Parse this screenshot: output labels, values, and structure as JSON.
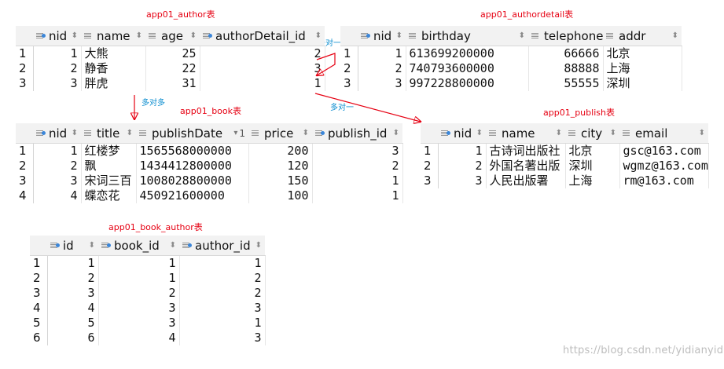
{
  "labels": {
    "author_title": "app01_author表",
    "authordetail_title": "app01_authordetail表",
    "book_title": "app01_book表",
    "publish_title": "app01_publish表",
    "book_author_title": "app01_book_author表",
    "one_to_one": "一对一",
    "many_to_many": "多对多",
    "many_to_one": "多对一"
  },
  "author": {
    "columns": [
      "nid",
      "name",
      "age",
      "authorDetail_id"
    ],
    "rows": [
      [
        "1",
        "1",
        "大熊",
        "25",
        "2"
      ],
      [
        "2",
        "2",
        "静香",
        "22",
        "3"
      ],
      [
        "3",
        "3",
        "胖虎",
        "31",
        "1"
      ]
    ]
  },
  "authordetail": {
    "columns": [
      "nid",
      "birthday",
      "telephone",
      "addr"
    ],
    "rows": [
      [
        "1",
        "1",
        "613699200000",
        "66666",
        "北京"
      ],
      [
        "2",
        "2",
        "740793600000",
        "88888",
        "上海"
      ],
      [
        "3",
        "3",
        "997228800000",
        "55555",
        "深圳"
      ]
    ]
  },
  "book": {
    "columns": [
      "nid",
      "title",
      "publishDate",
      "price",
      "publish_id"
    ],
    "sort_badge": "1",
    "rows": [
      [
        "1",
        "1",
        "红楼梦",
        "1565568000000",
        "200",
        "3"
      ],
      [
        "2",
        "2",
        "飘",
        "1434412800000",
        "120",
        "2"
      ],
      [
        "3",
        "3",
        "宋词三百",
        "1008028800000",
        "150",
        "1"
      ],
      [
        "4",
        "4",
        "蝶恋花",
        "450921600000",
        "100",
        "1"
      ]
    ]
  },
  "publish": {
    "columns": [
      "nid",
      "name",
      "city",
      "email"
    ],
    "rows": [
      [
        "1",
        "1",
        "古诗词出版社",
        "北京",
        "gsc@163.com"
      ],
      [
        "2",
        "2",
        "外国名著出版",
        "深圳",
        "wgmz@163.com"
      ],
      [
        "3",
        "3",
        "人民出版署",
        "上海",
        "rm@163.com"
      ]
    ]
  },
  "book_author": {
    "columns": [
      "id",
      "book_id",
      "author_id"
    ],
    "rows": [
      [
        "1",
        "1",
        "1",
        "1"
      ],
      [
        "2",
        "2",
        "1",
        "2"
      ],
      [
        "3",
        "3",
        "2",
        "2"
      ],
      [
        "4",
        "4",
        "3",
        "3"
      ],
      [
        "5",
        "5",
        "3",
        "1"
      ],
      [
        "6",
        "6",
        "4",
        "3"
      ]
    ]
  },
  "watermark": "https://blog.csdn.net/yidianyidei",
  "colors": {
    "table_title": "#e60012",
    "relation_label": "#0a8ccf",
    "arrow": "#e60012"
  }
}
